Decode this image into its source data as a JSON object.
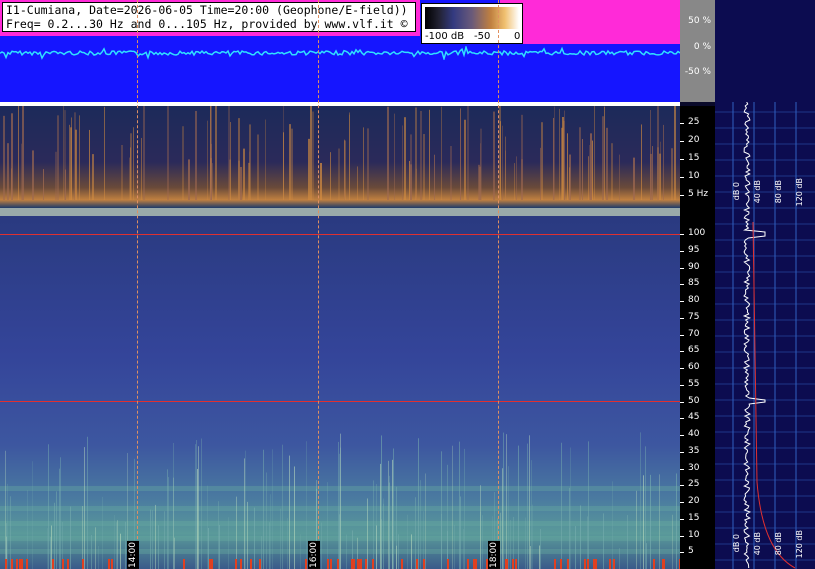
{
  "header": {
    "line1": "I1-Cumiana, Date=2026-06-05 Time=20:00 (Geophone/E-field))",
    "line2": "Freq= 0.2...30 Hz and 0...105 Hz, provided by www.vlf.it ©"
  },
  "color_scale": {
    "labels": [
      "-100 dB",
      "-50",
      "0"
    ]
  },
  "waveform_axis": {
    "ticks": [
      "50 %",
      "0 %",
      "-50 %"
    ]
  },
  "elf_axis": {
    "ticks": [
      "25",
      "20",
      "15",
      "10",
      "5 Hz"
    ]
  },
  "vlf_axis": {
    "ticks": [
      "100",
      "95",
      "90",
      "85",
      "80",
      "75",
      "70",
      "65",
      "60",
      "55",
      "50",
      "45",
      "40",
      "35",
      "30",
      "25",
      "20",
      "15",
      "10",
      "5"
    ]
  },
  "time_markers": [
    "14:00",
    "16:00",
    "18:00"
  ],
  "right_panel": {
    "top_labels": [
      "dB 0",
      "40 dB",
      "80 dB",
      "120 dB"
    ],
    "bottom_labels": [
      "dB 0",
      "40 dB",
      "80 dB",
      "120 dB"
    ]
  },
  "colors": {
    "waveform_bg": "#1515ff",
    "waveform_clip": "#ff2ad8",
    "spectrogram_base": "#2a3a80",
    "mains_line": "#e03030",
    "panel_bg": "#0c0c50"
  }
}
